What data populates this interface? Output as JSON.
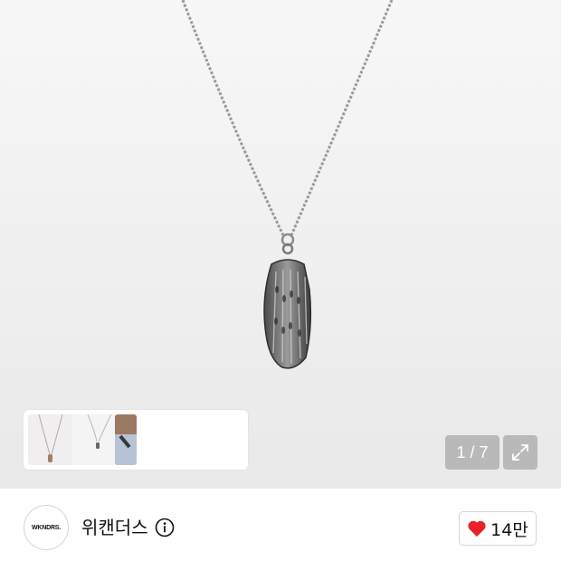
{
  "gallery": {
    "counter_text": "1 / 7",
    "current_index": 1,
    "total_images": 7
  },
  "brand": {
    "logo_text": "WKNDRS.",
    "name": "위캔더스"
  },
  "like": {
    "count": "14만",
    "heart_color": "#e8212a"
  },
  "icons": [
    "expand-icon",
    "info-icon",
    "heart-icon"
  ]
}
